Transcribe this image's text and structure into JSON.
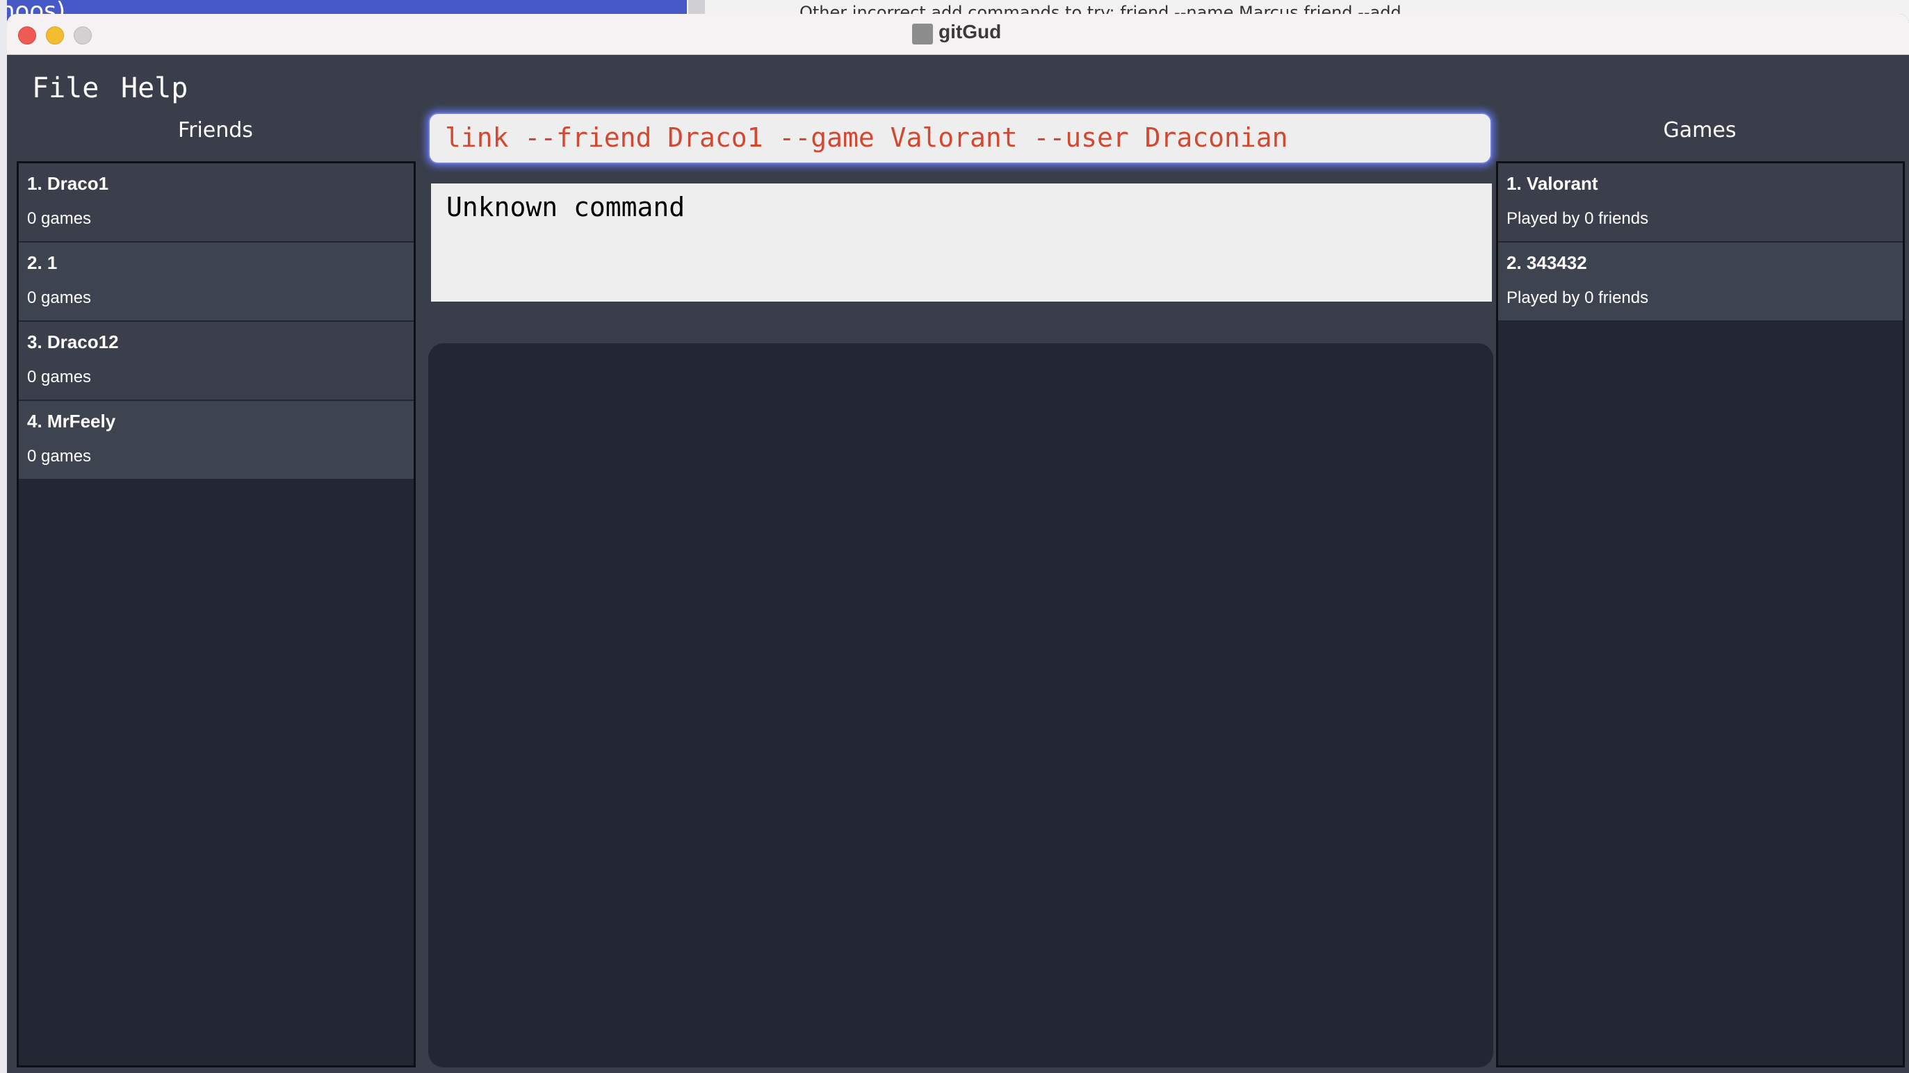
{
  "background": {
    "left_text": "hoos)",
    "right_text": "Other incorrect add commands to try: friend --name Marcus   friend --add"
  },
  "window": {
    "title": "gitGud"
  },
  "menu": {
    "file": "File",
    "help": "Help"
  },
  "friends": {
    "title": "Friends",
    "items": [
      {
        "name": "1. Draco1",
        "sub": "0 games"
      },
      {
        "name": "2. 1",
        "sub": "0 games"
      },
      {
        "name": "3. Draco12",
        "sub": "0 games"
      },
      {
        "name": "4. MrFeely",
        "sub": "0 games"
      }
    ]
  },
  "games": {
    "title": "Games",
    "items": [
      {
        "name": "1. Valorant",
        "sub": "Played by 0 friends"
      },
      {
        "name": "2. 343432",
        "sub": "Played by 0 friends"
      }
    ]
  },
  "command": {
    "value": "link --friend Draco1 --game Valorant --user Draconian"
  },
  "result": {
    "text": "Unknown command"
  },
  "colors": {
    "window_bg": "#393e4a",
    "panel_bg": "#222733",
    "list_item_bg": "#3b3f4b",
    "command_text": "#d04a33",
    "focus_ring": "#5e6fd8",
    "close": "#ee5b54",
    "minimize": "#f4bd2f",
    "maximize": "#d2d0d1"
  }
}
